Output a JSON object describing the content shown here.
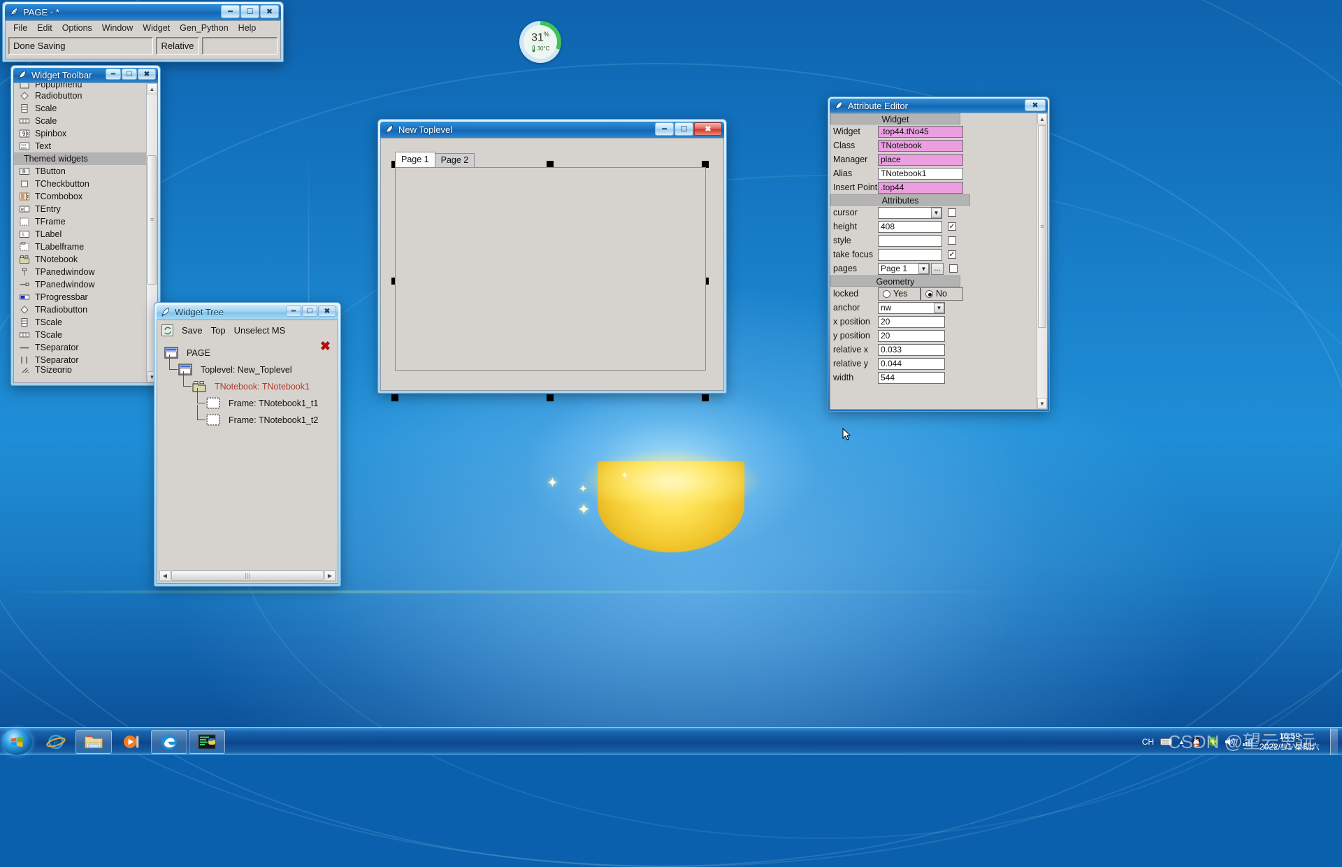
{
  "desktop": {
    "gauge": {
      "percent": "31",
      "percent_suffix": "%",
      "temperature": "30°C",
      "thermometer_icon": "thermometer-icon"
    }
  },
  "page_window": {
    "title": "PAGE - *",
    "app_icon": "feather-icon",
    "menu": [
      "File",
      "Edit",
      "Options",
      "Window",
      "Widget",
      "Gen_Python",
      "Help"
    ],
    "status_text": "Done Saving",
    "relative_button": "Relative",
    "extra_field": "",
    "buttons": {
      "minimize": "minimize-icon",
      "maximize": "maximize-icon",
      "close": "close-icon"
    }
  },
  "widget_toolbar": {
    "title": "Widget Toolbar",
    "app_icon": "feather-icon",
    "items": [
      {
        "label": "Popupmenu",
        "icon": "popupmenu-icon",
        "type": "item",
        "clipped": true
      },
      {
        "label": "Radiobutton",
        "icon": "radiobutton-icon",
        "type": "item"
      },
      {
        "label": "Scale",
        "icon": "scale-vertical-icon",
        "type": "item"
      },
      {
        "label": "Scale",
        "icon": "scale-horizontal-icon",
        "type": "item"
      },
      {
        "label": "Spinbox",
        "icon": "spinbox-icon",
        "type": "item"
      },
      {
        "label": "Text",
        "icon": "text-icon",
        "type": "item"
      },
      {
        "label": "Themed widgets",
        "icon": "",
        "type": "section"
      },
      {
        "label": "TButton",
        "icon": "tbutton-icon",
        "type": "item"
      },
      {
        "label": "TCheckbutton",
        "icon": "tcheckbutton-icon",
        "type": "item"
      },
      {
        "label": "TCombobox",
        "icon": "tcombobox-icon",
        "type": "item"
      },
      {
        "label": "TEntry",
        "icon": "tentry-icon",
        "type": "item"
      },
      {
        "label": "TFrame",
        "icon": "tframe-icon",
        "type": "item"
      },
      {
        "label": "TLabel",
        "icon": "tlabel-icon",
        "type": "item"
      },
      {
        "label": "TLabelframe",
        "icon": "tlabelframe-icon",
        "type": "item"
      },
      {
        "label": "TNotebook",
        "icon": "tnotebook-icon",
        "type": "item"
      },
      {
        "label": "TPanedwindow",
        "icon": "tpanedwindow-vertical-icon",
        "type": "item"
      },
      {
        "label": "TPanedwindow",
        "icon": "tpanedwindow-horizontal-icon",
        "type": "item"
      },
      {
        "label": "TProgressbar",
        "icon": "tprogressbar-icon",
        "type": "item"
      },
      {
        "label": "TRadiobutton",
        "icon": "tradiobutton-icon",
        "type": "item"
      },
      {
        "label": "TScale",
        "icon": "tscale-vertical-icon",
        "type": "item"
      },
      {
        "label": "TScale",
        "icon": "tscale-horizontal-icon",
        "type": "item"
      },
      {
        "label": "TSeparator",
        "icon": "tseparator-horizontal-icon",
        "type": "item"
      },
      {
        "label": "TSeparator",
        "icon": "tseparator-vertical-icon",
        "type": "item"
      },
      {
        "label": "TSizegrip",
        "icon": "tsizegrip-icon",
        "type": "item",
        "clipped": true
      }
    ]
  },
  "widget_tree": {
    "title": "Widget Tree",
    "app_icon": "feather-icon",
    "toolbar": {
      "refresh_icon": "refresh-icon",
      "save": "Save",
      "top": "Top",
      "unselect": "Unselect MS",
      "close_icon": "close-x-icon"
    },
    "nodes": [
      {
        "label": "PAGE",
        "indent": 0,
        "icon": "window-icon",
        "selected": false
      },
      {
        "label": "Toplevel: New_Toplevel",
        "indent": 1,
        "icon": "window-icon",
        "selected": false
      },
      {
        "label": "TNotebook: TNotebook1",
        "indent": 2,
        "icon": "notebook-icon",
        "selected": true
      },
      {
        "label": "Frame: TNotebook1_t1",
        "indent": 3,
        "icon": "frame-icon",
        "selected": false
      },
      {
        "label": "Frame: TNotebook1_t2",
        "indent": 3,
        "icon": "frame-icon",
        "selected": false
      }
    ]
  },
  "new_toplevel": {
    "title": "New Toplevel",
    "app_icon": "feather-icon",
    "tabs": [
      {
        "label": "Page 1",
        "active": true
      },
      {
        "label": "Page 2",
        "active": false
      }
    ],
    "buttons": {
      "minimize": "minimize-icon",
      "maximize": "maximize-icon",
      "close": "close-icon"
    }
  },
  "attribute_editor": {
    "title": "Attribute Editor",
    "app_icon": "feather-icon",
    "close_button": "close-icon",
    "sections": {
      "widget_header": "Widget",
      "attributes_header": "Attributes",
      "geometry_header": "Geometry"
    },
    "widget_rows": [
      {
        "label": "Widget",
        "value": ".top44.tNo45",
        "readonly": true
      },
      {
        "label": "Class",
        "value": "TNotebook",
        "readonly": true
      },
      {
        "label": "Manager",
        "value": "place",
        "readonly": true
      },
      {
        "label": "Alias",
        "value": "TNotebook1",
        "readonly": false
      },
      {
        "label": "Insert Point",
        "value": ".top44",
        "readonly": true
      }
    ],
    "attribute_rows": [
      {
        "label": "cursor",
        "value": "",
        "control": "combo",
        "checked": false
      },
      {
        "label": "height",
        "value": "408",
        "control": "entry",
        "checked": true
      },
      {
        "label": "style",
        "value": "",
        "control": "entry",
        "checked": false
      },
      {
        "label": "take focus",
        "value": "",
        "control": "entry",
        "checked": true
      },
      {
        "label": "pages",
        "value": "Page 1",
        "control": "combo-dots",
        "checked": false,
        "dots_label": "..."
      }
    ],
    "geometry_rows": [
      {
        "label": "locked",
        "control": "radio",
        "options": [
          "Yes",
          "No"
        ],
        "selected": "No"
      },
      {
        "label": "anchor",
        "value": "nw",
        "control": "combo"
      },
      {
        "label": "x position",
        "value": "20",
        "control": "entry"
      },
      {
        "label": "y position",
        "value": "20",
        "control": "entry"
      },
      {
        "label": "relative x",
        "value": "0.033",
        "control": "entry"
      },
      {
        "label": "relative y",
        "value": "0.044",
        "control": "entry"
      },
      {
        "label": "width",
        "value": "544",
        "control": "entry"
      }
    ]
  },
  "taskbar": {
    "start_label": "start-orb-icon",
    "pinned": [
      {
        "name": "internet-explorer-icon"
      },
      {
        "name": "file-explorer-icon"
      },
      {
        "name": "media-player-icon"
      }
    ],
    "running": [
      {
        "name": "edge-browser-icon"
      },
      {
        "name": "python-terminal-icon"
      }
    ],
    "tray": {
      "ime": "CH",
      "keyboard_icon": "keyboard-icon",
      "show_hidden_icon": "chevron-up-icon",
      "qq_icon": "qq-penguin-icon",
      "security_icon": "security-shield-icon",
      "volume_icon": "volume-icon",
      "network_icon": "network-icon"
    },
    "clock": {
      "time": "16:59",
      "date": "2022/1/1 星期六"
    },
    "show_desktop": "show-desktop-button"
  },
  "watermark": "CSDN @望云思远"
}
